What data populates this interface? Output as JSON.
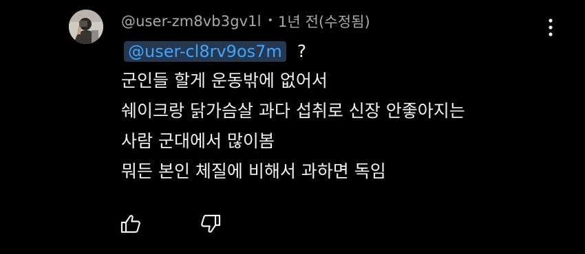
{
  "comment": {
    "author": "@user-zm8vb3gv1l",
    "separator": "•",
    "meta": "1년 전(수정됨)",
    "mention": "@user-cl8rv9os7m",
    "after_mention": "?",
    "lines": [
      "군인들 할게 운동밖에 없어서",
      "쉐이크랑 닭가슴살 과다 섭취로 신장 안좋아지는",
      "사람 군대에서 많이봄",
      "뭐든 본인 체질에 비해서 과하면 독임"
    ]
  },
  "icons": {
    "avatar": "avatar-photo",
    "more": "more-vertical-icon",
    "like": "thumbs-up-icon",
    "dislike": "thumbs-down-icon"
  },
  "colors": {
    "background": "#000000",
    "text": "#f1f1f1",
    "secondary_text": "#aaaaaa",
    "mention_text": "#3ea6ff",
    "mention_background": "#263850"
  }
}
